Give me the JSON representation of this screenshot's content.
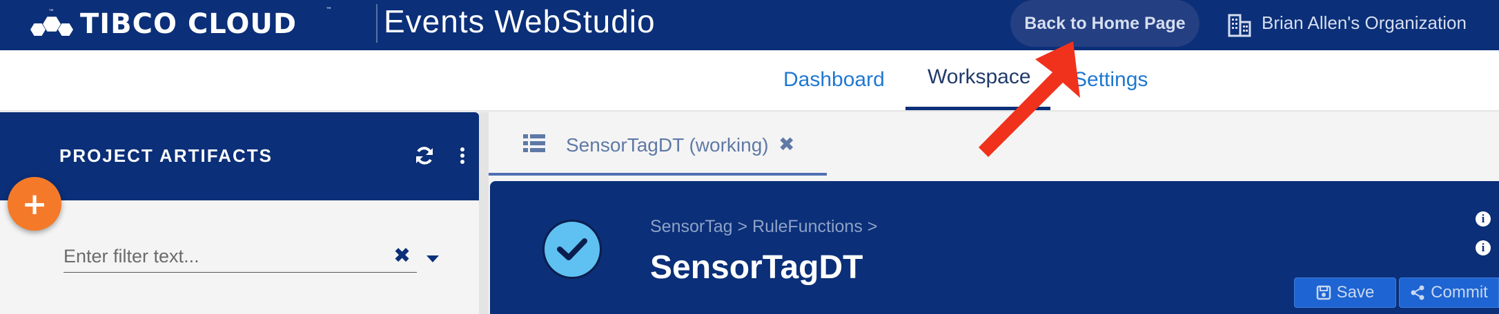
{
  "header": {
    "logo_text": "TIBCO CLOUD",
    "tm": "™",
    "app_title": "Events WebStudio",
    "home_button": "Back to Home Page",
    "org_name": "Brian Allen's Organization"
  },
  "nav": {
    "tabs": [
      {
        "label": "Dashboard",
        "active": false
      },
      {
        "label": "Workspace",
        "active": true
      },
      {
        "label": "Settings",
        "active": false
      }
    ]
  },
  "left_panel": {
    "title": "PROJECT ARTIFACTS",
    "add_label": "+",
    "filter_placeholder": "Enter filter text...",
    "filter_clear": "✖"
  },
  "editor": {
    "tab_label": "SensorTagDT (working)",
    "tab_close": "✖",
    "breadcrumb": "SensorTag > RuleFunctions >",
    "title": "SensorTagDT",
    "save_label": "Save",
    "commit_label": "Commit"
  },
  "colors": {
    "header_bg": "#0b2f78",
    "nav_link": "#1f78d1",
    "accent_orange": "#f47a2a",
    "check_blue": "#5fc0f2",
    "button_blue": "#1e64d2",
    "annotation_red": "#f0321c"
  }
}
